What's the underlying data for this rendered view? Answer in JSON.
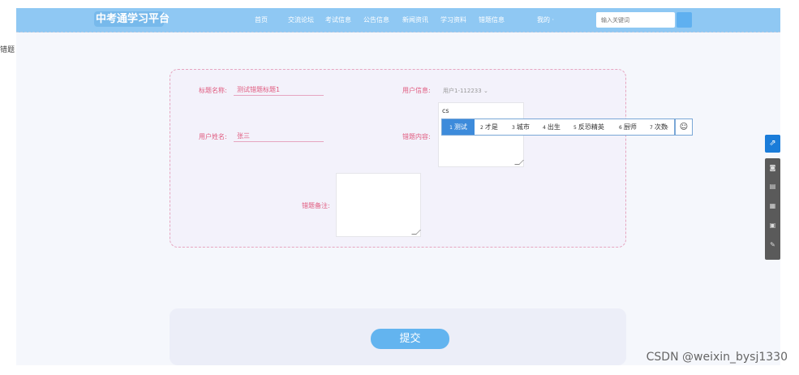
{
  "header": {
    "brand": "中考通学习平台",
    "nav": [
      "首页",
      "交流论坛",
      "考试信息",
      "公告信息",
      "新闻资讯",
      "学习资料",
      "错题信息",
      "我的 ·"
    ],
    "search_placeholder": "输入关键词"
  },
  "page_tag": "错题",
  "form": {
    "title_label": "标题名称:",
    "title_value": "测试错题标题1",
    "user_info_label": "用户信息:",
    "user_info_value": "用户1-112233",
    "user_name_label": "用户姓名:",
    "user_name_value": "张三",
    "content_label": "错题内容:",
    "content_typed": "cs",
    "remark_label": "错题备注:"
  },
  "ime": {
    "candidates": [
      {
        "n": "1",
        "text": "测试"
      },
      {
        "n": "2",
        "text": "才是"
      },
      {
        "n": "3",
        "text": "城市"
      },
      {
        "n": "4",
        "text": "出生"
      },
      {
        "n": "5",
        "text": "反恐精英"
      },
      {
        "n": "6",
        "text": "厨师"
      },
      {
        "n": "7",
        "text": "次数"
      }
    ],
    "emoji_icon": "smiley-icon"
  },
  "submit_label": "提交",
  "watermark": "CSDN @weixin_bysj1330",
  "sidebar_icons": [
    "share-icon",
    "camera-icon",
    "image-icon",
    "gif-icon",
    "screenshot-icon",
    "pen-icon"
  ]
}
